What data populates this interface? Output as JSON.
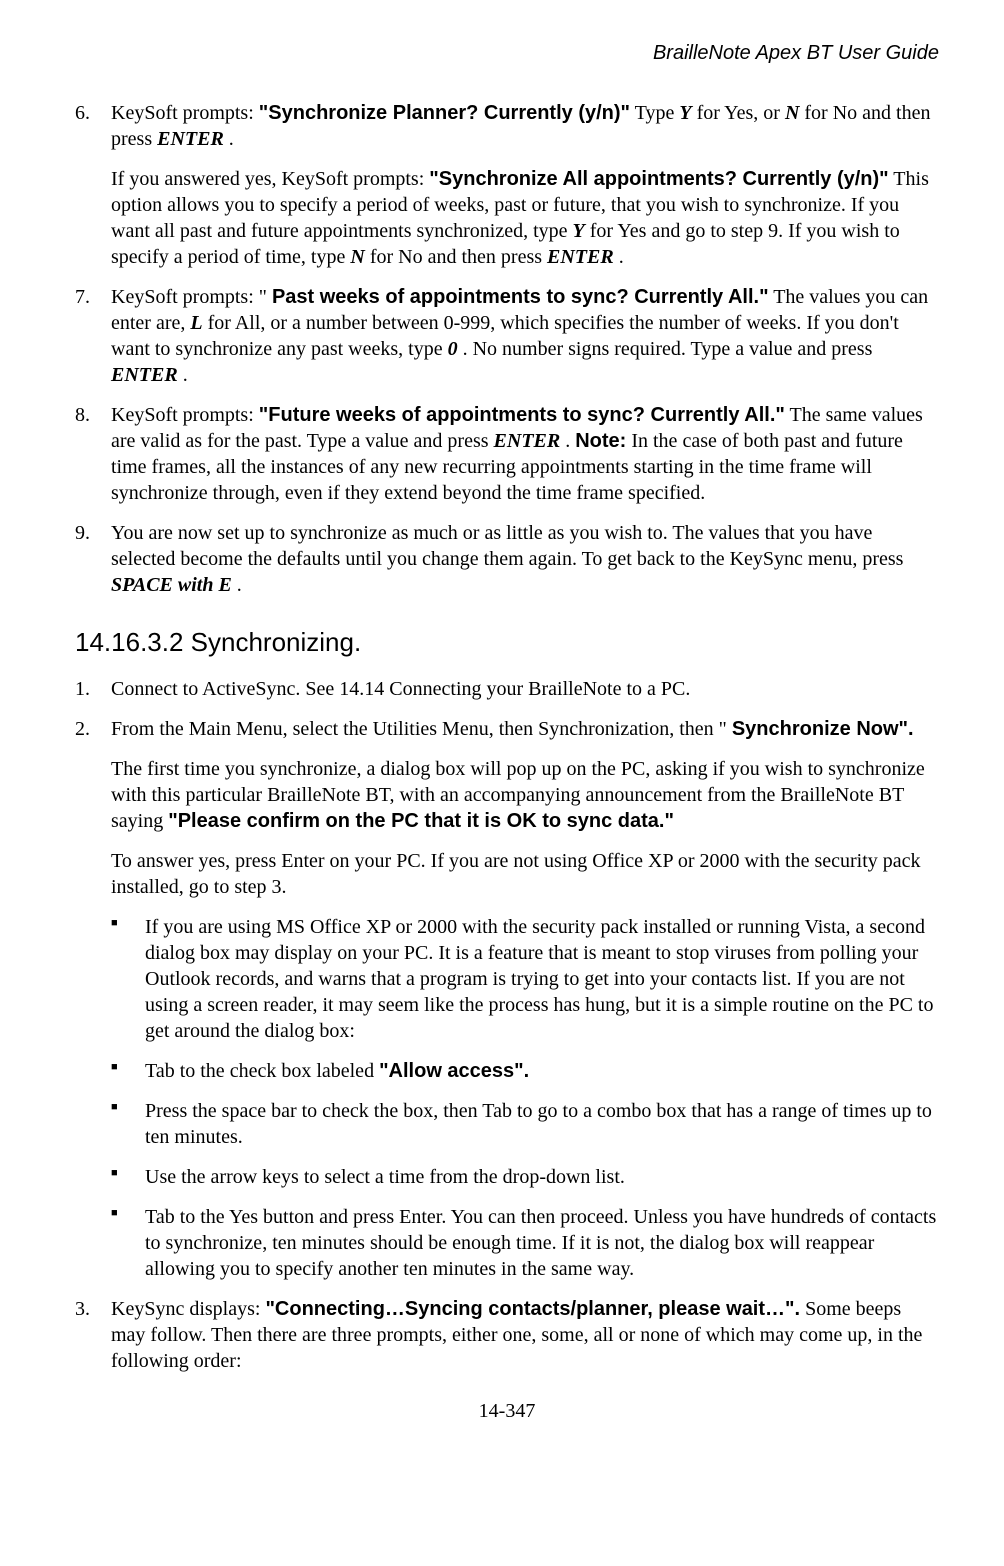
{
  "header": {
    "title": "BrailleNote Apex BT User Guide"
  },
  "section1": {
    "i6": {
      "num": "6.",
      "t1": "KeySoft prompts: ",
      "q1": "\"Synchronize Planner? Currently (y/n)\"",
      "t2": " Type ",
      "y": "Y",
      "t3": " for Yes, or ",
      "n": "N",
      "t4": " for No and then press ",
      "enter": "ENTER",
      "t5": "."
    },
    "i6b": {
      "t1": "If you answered yes, KeySoft prompts: ",
      "q1": "\"Synchronize All appointments? Currently (y/n)\"",
      "t2": " This option allows you to specify a period of weeks, past or future, that you wish to synchronize. If you want all past and future appointments synchronized, type ",
      "y": "Y",
      "t3": " for Yes and go to step 9. If you wish to specify a period of time, type ",
      "n": "N",
      "t4": " for No and then press ",
      "enter": "ENTER",
      "t5": "."
    },
    "i7": {
      "num": "7.",
      "t1": "KeySoft prompts: \"",
      "q1": "Past weeks of appointments to sync? Currently All.\"",
      "t2": " The values you can enter are, ",
      "L": "L",
      "t3": " for All, or a number between 0-999, which specifies the number of weeks. If you don't want to synchronize any past weeks, type ",
      "zero": "0",
      "t4": ". No number signs required. Type a value and press ",
      "enter": "ENTER",
      "t5": "."
    },
    "i8": {
      "num": "8.",
      "t1": "KeySoft prompts: ",
      "q1": "\"Future weeks of appointments to sync? Currently All.\"",
      "t2": " The same values are valid as for the past. Type a value and press ",
      "enter": "ENTER",
      "t3": ". ",
      "note": "Note:",
      "t4": " In the case of both past and future time frames, all the instances of any new recurring appointments starting in the time frame will synchronize through, even if they extend beyond the time frame specified."
    },
    "i9": {
      "num": "9.",
      "t1": "You are now set up to synchronize as much or as little as you wish to. The values that you have selected become the defaults until you change them again. To get back to the KeySync menu, press ",
      "space": "SPACE with E",
      "t2": "."
    }
  },
  "heading": "14.16.3.2   Synchronizing.",
  "section2": {
    "i1": {
      "num": "1.",
      "t1": "Connect to ActiveSync. See 14.14 Connecting your BrailleNote to a PC."
    },
    "i2": {
      "num": "2.",
      "t1": "From the Main Menu, select the Utilities Menu, then Synchronization, then \"",
      "q1": "Synchronize Now\".",
      "p2a": "The first time you synchronize, a dialog box will pop up on the PC, asking if you wish to synchronize with this particular BrailleNote BT, with an accompanying announcement from the BrailleNote BT saying ",
      "p2q": "\"Please confirm on the PC that it is OK to sync data.\"",
      "p3": "To answer yes, press Enter on your PC. If you are not using Office XP or 2000 with the security pack installed, go to step 3."
    },
    "bullets": {
      "b1": "If you are using MS Office XP or 2000 with the security pack installed or running Vista, a second dialog box may display on your PC. It is a feature that is meant to stop viruses from polling your Outlook records, and warns that a program is trying to get into your contacts list. If you are not using a screen reader, it may seem like the process has hung, but it is a simple routine on the PC to get around the dialog box:",
      "b2a": "Tab to the check box labeled ",
      "b2q": "\"Allow access\".",
      "b3": "Press the space bar to check the box, then Tab to go to a combo box that has a range of times up to ten minutes.",
      "b4": "Use the arrow keys to select a time from the drop-down list.",
      "b5": "Tab to the Yes button and press Enter. You can then proceed. Unless you have hundreds of contacts to synchronize, ten minutes should be enough time. If it is not, the dialog box will reappear allowing you to specify another ten minutes in the same way."
    },
    "i3": {
      "num": "3.",
      "t1": "KeySync displays: ",
      "q1": "\"Connecting…Syncing contacts/planner, please wait…\".",
      "t2": " Some beeps may follow. Then there are three prompts, either one, some, all or none of which may come up, in the following order:"
    }
  },
  "footer": "14-347"
}
